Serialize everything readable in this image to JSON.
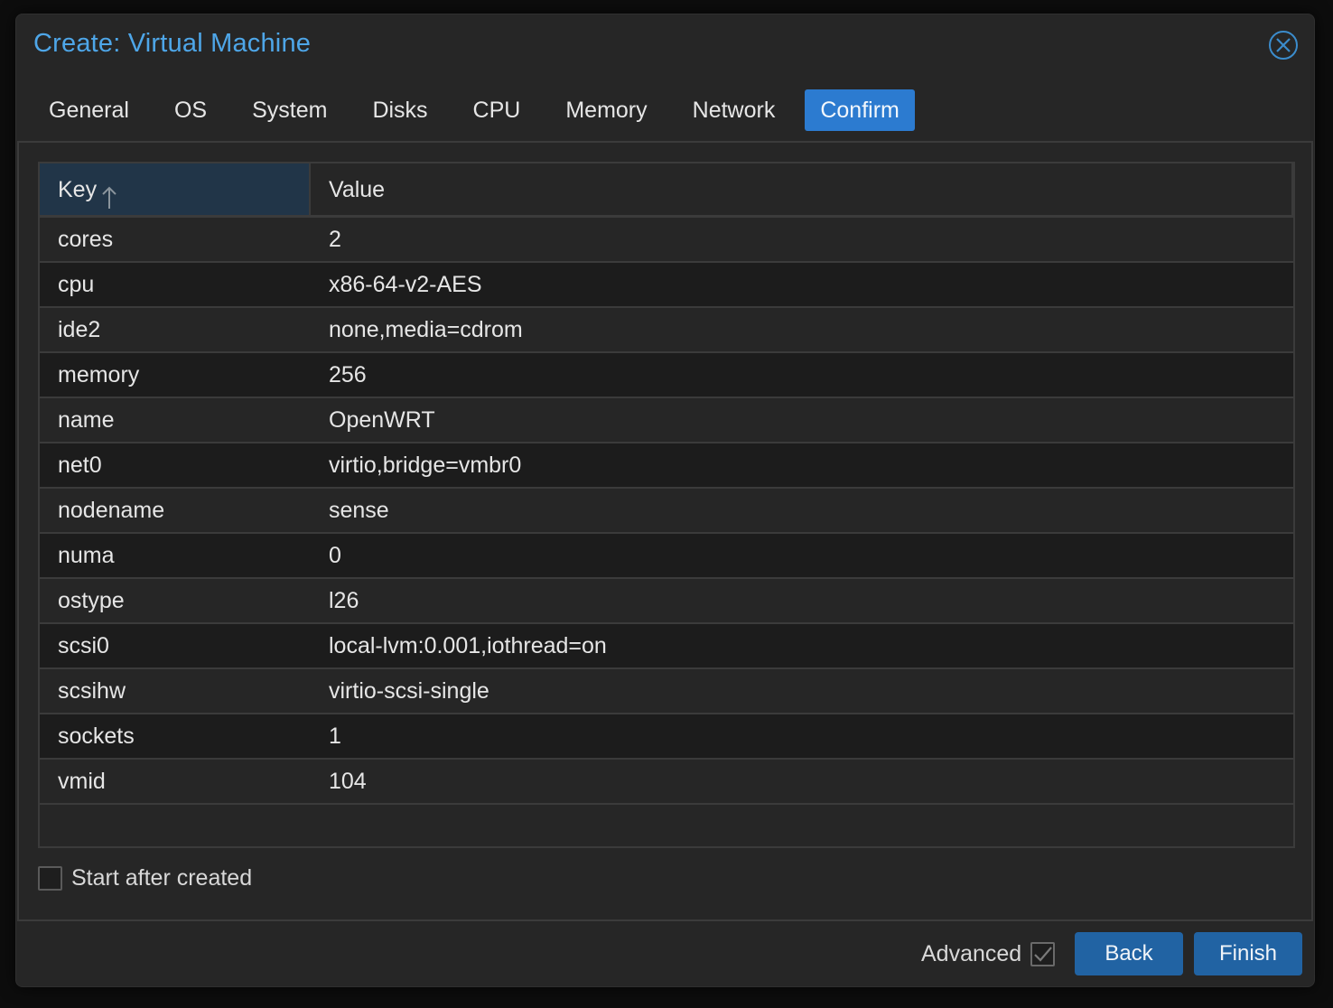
{
  "window": {
    "title": "Create: Virtual Machine",
    "close_icon": "close-circle-icon"
  },
  "tabs": [
    {
      "label": "General",
      "active": false
    },
    {
      "label": "OS",
      "active": false
    },
    {
      "label": "System",
      "active": false
    },
    {
      "label": "Disks",
      "active": false
    },
    {
      "label": "CPU",
      "active": false
    },
    {
      "label": "Memory",
      "active": false
    },
    {
      "label": "Network",
      "active": false
    },
    {
      "label": "Confirm",
      "active": true
    }
  ],
  "grid": {
    "columns": {
      "key": "Key",
      "value": "Value",
      "sort": "ascending",
      "sort_icon": "arrow-up-icon"
    },
    "rows": [
      {
        "key": "cores",
        "value": "2"
      },
      {
        "key": "cpu",
        "value": "x86-64-v2-AES"
      },
      {
        "key": "ide2",
        "value": "none,media=cdrom"
      },
      {
        "key": "memory",
        "value": "256"
      },
      {
        "key": "name",
        "value": "OpenWRT"
      },
      {
        "key": "net0",
        "value": "virtio,bridge=vmbr0"
      },
      {
        "key": "nodename",
        "value": "sense"
      },
      {
        "key": "numa",
        "value": "0"
      },
      {
        "key": "ostype",
        "value": "l26"
      },
      {
        "key": "scsi0",
        "value": "local-lvm:0.001,iothread=on"
      },
      {
        "key": "scsihw",
        "value": "virtio-scsi-single"
      },
      {
        "key": "sockets",
        "value": "1"
      },
      {
        "key": "vmid",
        "value": "104"
      }
    ]
  },
  "start_after_created": {
    "label": "Start after created",
    "checked": false
  },
  "footer": {
    "advanced_label": "Advanced",
    "advanced_checked": true,
    "back_label": "Back",
    "finish_label": "Finish"
  },
  "colors": {
    "accent": "#2c7bd0",
    "title": "#4ea6e8",
    "button": "#2163a3",
    "sorted_header": "#213548"
  }
}
